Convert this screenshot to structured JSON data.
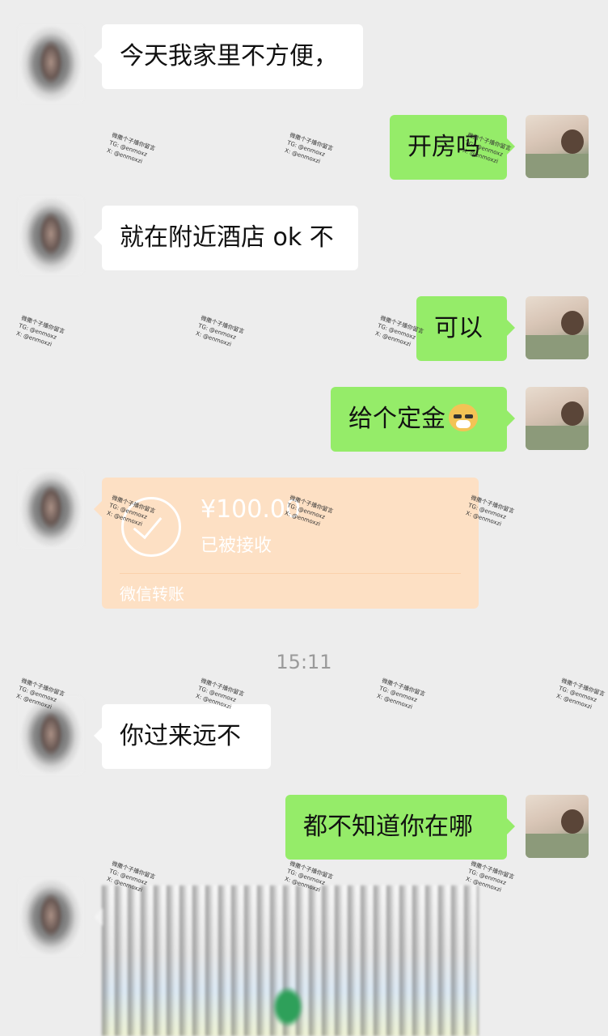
{
  "messages": [
    {
      "side": "left",
      "text": "今天我家里不方便，"
    },
    {
      "side": "right",
      "text": "开房吗"
    },
    {
      "side": "left",
      "text": "就在附近酒店 ok 不"
    },
    {
      "side": "right",
      "text": "可以"
    },
    {
      "side": "right",
      "text": "给个定金",
      "emoji": "doge-emoji"
    },
    {
      "side": "left",
      "type": "transfer"
    },
    {
      "side": "left",
      "text": "你过来远不"
    },
    {
      "side": "right",
      "text": "都不知道你在哪"
    },
    {
      "side": "left",
      "type": "image"
    }
  ],
  "transfer": {
    "amount": "¥100.00",
    "status": "已被接收",
    "source": "微信转账",
    "color": "#fde0c4"
  },
  "timestamp": "15:11",
  "watermark": {
    "line1": "微撒个子播你留言",
    "line2": "TG:    @enmoxz",
    "line3": "X: @enmoxzi"
  },
  "colors": {
    "background": "#ededed",
    "incoming_bubble": "#ffffff",
    "outgoing_bubble": "#95ec69"
  }
}
